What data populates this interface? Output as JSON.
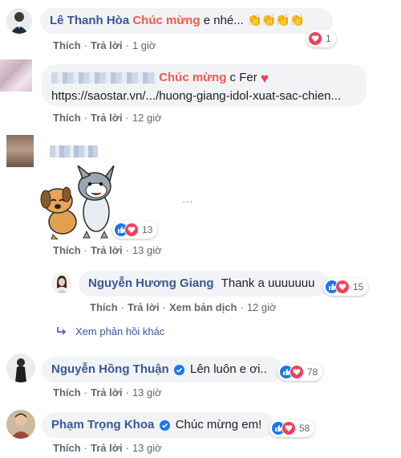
{
  "comments": [
    {
      "author": "Lê Thanh Hòa",
      "highlight": "Chúc mừng",
      "text": "e nhé...",
      "emoji": "👏👏👏👏",
      "actions": {
        "like": "Thích",
        "reply": "Trả lời",
        "time": "1 giờ"
      },
      "reactions": {
        "count": "1",
        "types": [
          "love"
        ]
      }
    },
    {
      "author": "",
      "highlight": "Chúc mừng",
      "text": "c Fer",
      "link": "https://saostar.vn/.../huong-giang-idol-xuat-sac-chien...",
      "actions": {
        "like": "Thích",
        "reply": "Trả lời",
        "time": "12 giờ"
      }
    },
    {
      "author": "",
      "sticker": "dog-and-cat-sticker",
      "actions": {
        "like": "Thích",
        "reply": "Trả lời",
        "time": "13 giờ"
      },
      "reactions": {
        "count": "13",
        "types": [
          "like",
          "love"
        ]
      }
    },
    {
      "author": "Nguyễn Hương Giang",
      "text": "Thank a uuuuuuu",
      "actions": {
        "like": "Thích",
        "reply": "Trả lời",
        "translate": "Xem bản dịch",
        "time": "12 giờ"
      },
      "reactions": {
        "count": "15",
        "types": [
          "like",
          "love"
        ]
      },
      "more_replies": "Xem phản hồi khác"
    },
    {
      "author": "Nguyễn Hồng Thuận",
      "verified": true,
      "text": "Lên luôn e ơi..",
      "actions": {
        "like": "Thích",
        "reply": "Trả lời",
        "time": "13 giờ"
      },
      "reactions": {
        "count": "78",
        "types": [
          "like",
          "love"
        ]
      }
    },
    {
      "author": "Phạm Trọng Khoa",
      "verified": true,
      "text": "Chúc mừng em!",
      "actions": {
        "like": "Thích",
        "reply": "Trả lời",
        "time": "13 giờ"
      },
      "reactions": {
        "count": "58",
        "types": [
          "like",
          "love"
        ]
      }
    }
  ],
  "colors": {
    "author": "#385898",
    "highlight": "#f05a4c",
    "like": "#1877f2",
    "love": "#f33e58",
    "bubble": "#f2f3f5"
  }
}
